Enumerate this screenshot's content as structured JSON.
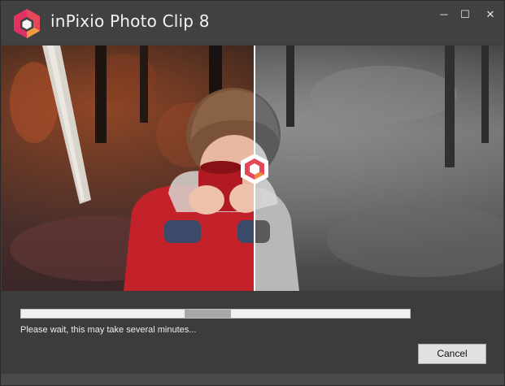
{
  "window": {
    "title": "inPixio Photo Clip 8",
    "controls": {
      "minimize": "─",
      "maximize": "☐",
      "close": "✕"
    },
    "logo_icon": "inpixio-logo-icon"
  },
  "preview": {
    "description_icon": "before-after-split",
    "divider_handle_icon": "inpixio-logo-icon"
  },
  "progress": {
    "indeterminate": true,
    "chunk_start": 0.42,
    "chunk_end": 0.54
  },
  "status": {
    "message": "Please wait, this may take several minutes..."
  },
  "buttons": {
    "cancel": "Cancel"
  },
  "colors": {
    "brand_gradient_start": "#e8355b",
    "brand_gradient_end": "#f08a3a",
    "jacket_red": "#c4222a",
    "background_dark": "#3c3c3c"
  }
}
